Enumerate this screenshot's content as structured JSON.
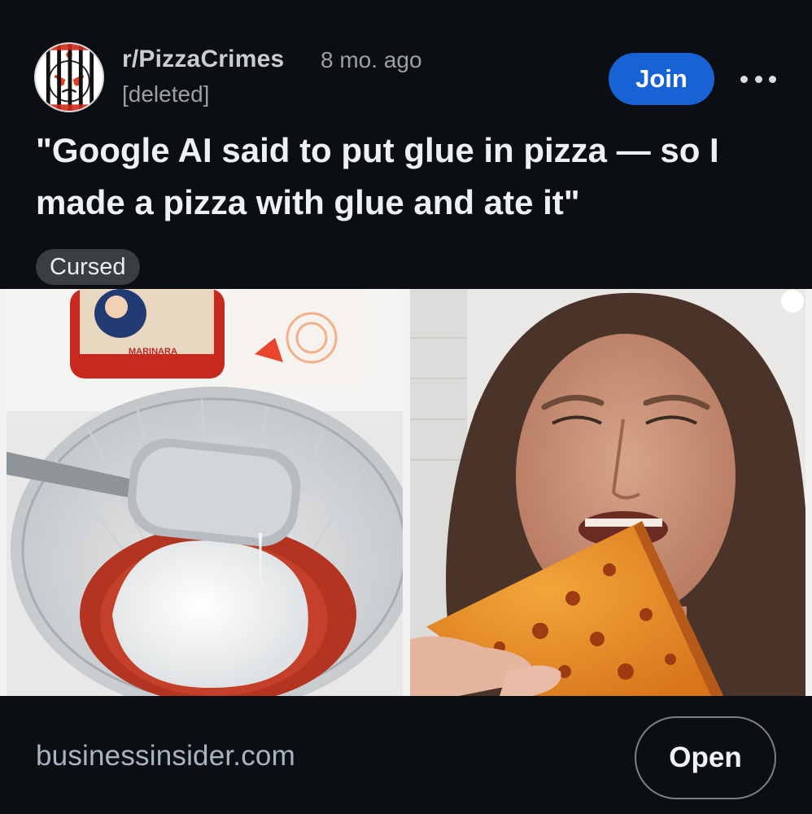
{
  "post": {
    "subreddit": "r/PizzaCrimes",
    "age": "8 mo. ago",
    "author": "[deleted]",
    "title": "\"Google AI said to put glue in pizza — so I made a pizza with glue and ate it\"",
    "flair": "Cursed",
    "join_label": "Join",
    "avatar_icon": "subreddit-avatar-jail-icon",
    "more_icon": "more-options-icon",
    "media": {
      "left_image_text": "MARINARA",
      "left_image_icon": "marinara-and-glue-bowl-photo",
      "right_image_icon": "woman-eating-pizza-photo"
    }
  },
  "footer": {
    "domain": "businessinsider.com",
    "open_label": "Open"
  },
  "colors": {
    "background": "#0b0f14",
    "join_button": "#1763d6",
    "flair_bg": "#3a3d42",
    "muted_text": "#9aa0a6"
  }
}
